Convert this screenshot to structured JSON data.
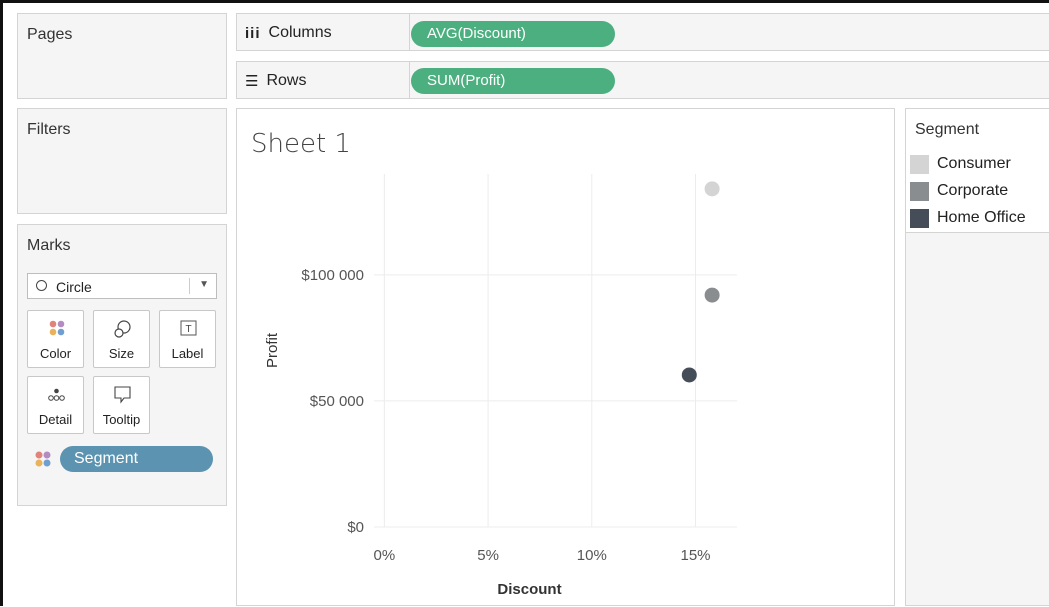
{
  "pages": {
    "title": "Pages"
  },
  "filters": {
    "title": "Filters"
  },
  "marks": {
    "title": "Marks",
    "mark_type": "Circle",
    "buttons": [
      "Color",
      "Size",
      "Label",
      "Detail",
      "Tooltip"
    ],
    "color_field": "Segment"
  },
  "shelves": {
    "columns": {
      "label": "Columns",
      "pill": "AVG(Discount)"
    },
    "rows": {
      "label": "Rows",
      "pill": "SUM(Profit)"
    }
  },
  "sheet": {
    "title": "Sheet 1"
  },
  "legend": {
    "title": "Segment",
    "items": [
      {
        "label": "Consumer",
        "color": "#d4d4d4"
      },
      {
        "label": "Corporate",
        "color": "#8a8d8f"
      },
      {
        "label": "Home Office",
        "color": "#454d59"
      }
    ]
  },
  "colors": {
    "pill_green": "#4caf7f",
    "pill_blue": "#5b93b1"
  },
  "chart_data": {
    "type": "scatter",
    "title": "Sheet 1",
    "xlabel": "Discount",
    "ylabel": "Profit",
    "x_ticks": [
      "0%",
      "5%",
      "10%",
      "15%"
    ],
    "y_ticks": [
      "$0",
      "$50 000",
      "$100 000"
    ],
    "xlim": [
      -0.005,
      0.17
    ],
    "ylim": [
      0,
      140000
    ],
    "grid": true,
    "series": [
      {
        "name": "Consumer",
        "color": "#d4d4d4",
        "x": 0.158,
        "y": 134119
      },
      {
        "name": "Corporate",
        "color": "#8a8d8f",
        "x": 0.158,
        "y": 91979
      },
      {
        "name": "Home Office",
        "color": "#454d59",
        "x": 0.147,
        "y": 60299
      }
    ]
  }
}
